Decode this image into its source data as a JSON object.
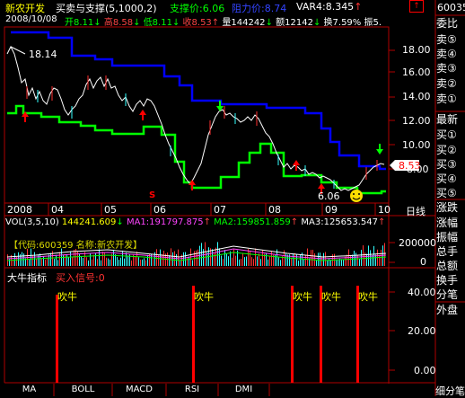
{
  "header": {
    "stock_name": "新农开发",
    "indicator": "买卖与支撑(5,1000,2)",
    "support_label": "支撑价:6.06",
    "resistance_label": "阻力价:8.74",
    "var4_label": "VAR4:8.345",
    "var4_arrow": "↑",
    "date": "2008/10/08",
    "open_label": "开8.11",
    "open_arrow": "↓",
    "high_label": "高8.58",
    "high_arrow": "↓",
    "low_label": "低8.11",
    "low_arrow": "↓",
    "close_label": "收8.53",
    "close_arrow": "↑",
    "volume_label": "量144242",
    "volume_arrow": "↓",
    "amount_label": "额12142",
    "amount_arrow": "↓",
    "turnover_label": "换7.59%",
    "amplitude_label": "振5."
  },
  "price_panel": {
    "y_ticks": [
      "18.00",
      "16.00",
      "14.00",
      "12.00",
      "10.00",
      "8.00"
    ],
    "high_annotation": "18.14",
    "low_annotation": "6.06",
    "current_price": "8.53",
    "x_labels": [
      "2008",
      "04",
      "05",
      "06",
      "07",
      "08",
      "09",
      "10"
    ],
    "period_label": "日线",
    "sell_marker": "S",
    "colors": {
      "resistance": "#0000ff",
      "support": "#00ff00",
      "price": "#ffffff",
      "up_arrow": "#ff0000",
      "down_arrow": "#00ff00"
    }
  },
  "volume_panel": {
    "title": "VOL(3,5,10)",
    "value": "144241.609",
    "value_arrow": "↓",
    "ma1": "MA1:191797.875",
    "ma1_arrow": "↑",
    "ma2": "MA2:159851.859",
    "ma2_arrow": "↑",
    "ma3": "MA3:125653.547",
    "ma3_arrow": "↑",
    "code_label": "【代码:600359 名称:新农开发】",
    "y_ticks": [
      "200000",
      "0"
    ]
  },
  "indicator_panel": {
    "title": "大牛指标",
    "signal_label": "买入信号:0",
    "y_ticks": [
      "40.00",
      "20.00",
      "0.00"
    ],
    "bar_label": "吹牛"
  },
  "tabs": [
    "MA",
    "BOLL",
    "MACD",
    "RSI",
    "DMI"
  ],
  "sidebar": {
    "code": "60035",
    "items": [
      "委比",
      "卖⑤",
      "卖④",
      "卖③",
      "卖②",
      "卖①",
      "最新",
      "买①",
      "买②",
      "买③",
      "买④",
      "买⑤",
      "涨跌",
      "涨幅",
      "振幅",
      "总手",
      "总额",
      "换手",
      "分笔",
      "外盘"
    ],
    "footer": "细分笔"
  }
}
